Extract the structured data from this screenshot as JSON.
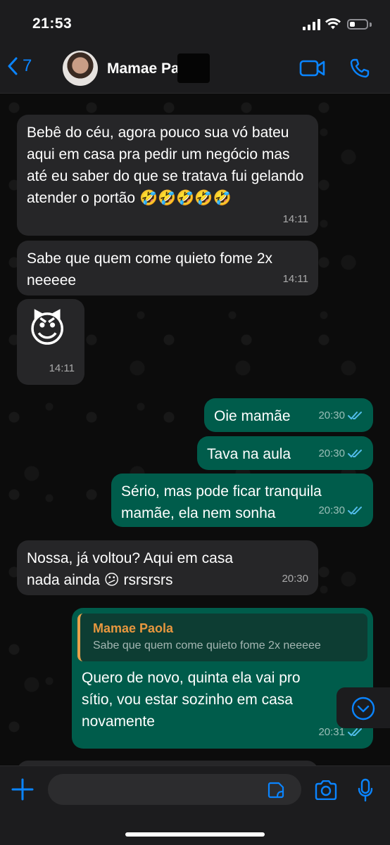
{
  "status_bar": {
    "time": "21:53"
  },
  "header": {
    "back_count": "7",
    "contact_name": "Mamae Pa"
  },
  "messages": [
    {
      "text": "Bebê do céu, agora pouco sua vó bateu aqui em casa pra pedir um negócio mas até eu saber do que se tratava fui gelando atender o portão 🤣🤣🤣🤣🤣",
      "time": "14:11"
    },
    {
      "text": "Sabe que quem come quieto fome 2x neeeee",
      "time": "14:11"
    },
    {
      "text": "😈",
      "time": "14:11"
    },
    {
      "text": "Oie mamãe",
      "time": "20:30"
    },
    {
      "text": "Tava na aula",
      "time": "20:30"
    },
    {
      "text": "Sério, mas pode ficar tranquila mamãe, ela nem sonha",
      "time": "20:30"
    },
    {
      "text": "Nossa, já voltou? Aqui em casa nada ainda 😕 rsrsrsrs",
      "time": "20:30"
    },
    {
      "reply_author": "Mamae Paola",
      "reply_text": "Sabe que quem come quieto fome 2x neeeee",
      "text": "Quero de novo, quinta ela vai pro sítio, vou estar sozinho em casa novamente",
      "time": "20:31"
    }
  ],
  "input": {
    "placeholder": "",
    "value": ""
  },
  "colors": {
    "accent": "#0a84ff",
    "outgoing_bubble": "#005c4b",
    "incoming_bubble": "#262628",
    "reply_author": "#e8973f",
    "read_ticks": "#53bdeb"
  },
  "icons": [
    "back-chevron-icon",
    "video-call-icon",
    "voice-call-icon",
    "read-ticks-icon",
    "scroll-down-icon",
    "plus-icon",
    "sticker-icon",
    "camera-icon",
    "microphone-icon"
  ]
}
